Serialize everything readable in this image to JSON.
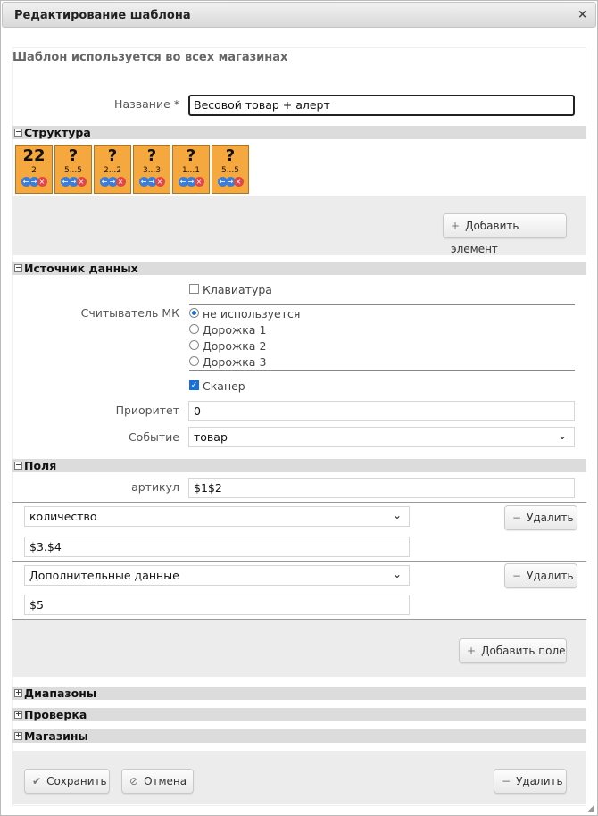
{
  "dialog": {
    "title": "Редактирование шаблона",
    "close_icon": "×"
  },
  "notice": "Шаблон используется во всех магазинах",
  "name_field": {
    "label": "Название *",
    "value": "Весовой товар + алерт"
  },
  "structure": {
    "header": "Структура",
    "tiles": [
      {
        "big": "22",
        "small": "2"
      },
      {
        "big": "?",
        "small": "5...5"
      },
      {
        "big": "?",
        "small": "2...2"
      },
      {
        "big": "?",
        "small": "3...3"
      },
      {
        "big": "?",
        "small": "1...1"
      },
      {
        "big": "?",
        "small": "5...5"
      }
    ],
    "add_button": "Добавить элемент"
  },
  "data_source": {
    "header": "Источник данных",
    "keyboard": "Клавиатура",
    "reader_label": "Считыватель МК",
    "reader_options": [
      "не используется",
      "Дорожка 1",
      "Дорожка 2",
      "Дорожка 3"
    ],
    "reader_selected": "не используется",
    "scanner": "Сканер",
    "priority_label": "Приоритет",
    "priority_value": "0",
    "event_label": "Событие",
    "event_value": "товар"
  },
  "fields": {
    "header": "Поля",
    "article_label": "артикул",
    "article_value": "$1$2",
    "rows": [
      {
        "select": "количество",
        "value": "$3.$4",
        "delete": "Удалить"
      },
      {
        "select": "Дополнительные данные",
        "value": "$5",
        "delete": "Удалить"
      }
    ],
    "add_button": "Добавить поле"
  },
  "ranges_header": "Диапазоны",
  "check_header": "Проверка",
  "stores_header": "Магазины",
  "footer": {
    "save": "Сохранить",
    "cancel": "Отмена",
    "delete": "Удалить"
  },
  "colors": {
    "tile": "#f5a83d",
    "accent": "#1a6fd6",
    "section_bg": "#dcdcdc"
  }
}
